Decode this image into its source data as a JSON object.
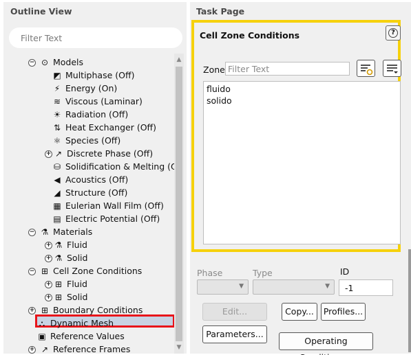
{
  "outline": {
    "title": "Outline View",
    "filter_placeholder": "Filter Text",
    "tree": [
      {
        "label": "Models",
        "expander": "−",
        "icon": "⊙"
      },
      {
        "label": "Multiphase (Off)",
        "icon": "◩"
      },
      {
        "label": "Energy (On)",
        "icon": "⚡"
      },
      {
        "label": "Viscous (Laminar)",
        "icon": "≋"
      },
      {
        "label": "Radiation (Off)",
        "icon": "☀"
      },
      {
        "label": "Heat Exchanger (Off)",
        "icon": "⇅"
      },
      {
        "label": "Species (Off)",
        "icon": "⚛"
      },
      {
        "label": "Discrete Phase (Off)",
        "expander": "+",
        "icon": "↗"
      },
      {
        "label": "Solidification & Melting (Off)",
        "icon": "⛁"
      },
      {
        "label": "Acoustics (Off)",
        "icon": "◀"
      },
      {
        "label": "Structure (Off)",
        "icon": "◢"
      },
      {
        "label": "Eulerian Wall Film (Off)",
        "icon": "▦"
      },
      {
        "label": "Electric Potential (Off)",
        "icon": "▤"
      },
      {
        "label": "Materials",
        "expander": "−",
        "icon": "⚗"
      },
      {
        "label": "Fluid",
        "expander": "+",
        "icon": "⚗"
      },
      {
        "label": "Solid",
        "expander": "+",
        "icon": "⚗"
      },
      {
        "label": "Cell Zone Conditions",
        "expander": "−",
        "icon": "⊞"
      },
      {
        "label": "Fluid",
        "expander": "+",
        "icon": "⊞"
      },
      {
        "label": "Solid",
        "expander": "+",
        "icon": "⊞"
      },
      {
        "label": "Boundary Conditions",
        "expander": "+",
        "icon": "⊞"
      },
      {
        "label": "Dynamic Mesh",
        "icon": "⛬"
      },
      {
        "label": "Reference Values",
        "icon": "▣"
      },
      {
        "label": "Reference Frames",
        "expander": "+",
        "icon": "↗"
      }
    ]
  },
  "task": {
    "title": "Task Page",
    "panel_title": "Cell Zone Conditions",
    "help_icon": "?",
    "zone_label": "Zone",
    "zone_filter_placeholder": "Filter Text",
    "zones": [
      "fluido",
      "solido"
    ],
    "phase_label": "Phase",
    "type_label": "Type",
    "id_label": "ID",
    "id_value": "-1",
    "buttons": {
      "edit": "Edit...",
      "copy": "Copy...",
      "profiles": "Profiles...",
      "parameters": "Parameters...",
      "operating_conditions": "Operating Conditions..."
    }
  },
  "colors": {
    "selection_border": "#e8141a",
    "task_highlight": "#f6d10c",
    "selection_fill": "#c8d3e3"
  }
}
